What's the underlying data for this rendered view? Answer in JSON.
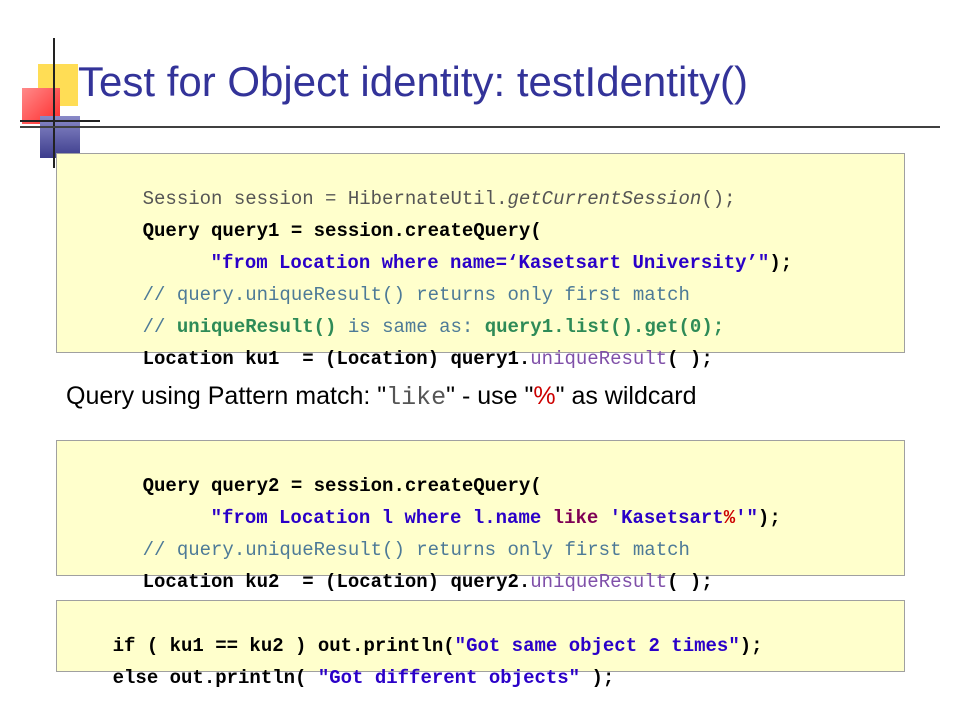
{
  "title": "Test for Object identity: testIdentity()",
  "caption": {
    "part1": "Query using Pattern match: \"",
    "like": "like",
    "part2": "\" - use \"",
    "pct": "%",
    "part3": "\" as wildcard"
  },
  "box1": {
    "l1a": "Session session = HibernateUtil.",
    "l1b": "getCurrentSession",
    "l1c": "();",
    "l2": "Query query1 = session.createQuery(",
    "l3a": "\"from Location where name=‘Kasetsart University’\"",
    "l3b": ");",
    "l4": "// query.uniqueResult() returns only first match",
    "l5a": "// ",
    "l5b": "uniqueResult()",
    "l5c": " is same as: ",
    "l5d": "query1.list().get(0);",
    "l6a": "Location ku1  = (Location) query1.",
    "l6b": "uniqueResult",
    "l6c": "( );"
  },
  "box2": {
    "l1": "Query query2 = session.createQuery(",
    "l2a": "\"from Location l where l.name ",
    "l2b": "like",
    "l2c": " 'Kasetsart",
    "l2d": "%",
    "l2e": "'\"",
    "l2f": ");",
    "l3": "// query.uniqueResult() returns only first match",
    "l4a": "Location ku2  = (Location) query2.",
    "l4b": "uniqueResult",
    "l4c": "( );"
  },
  "box3": {
    "l1a": "if ( ku1 == ku2 ) out.println(",
    "l1b": "\"Got same object 2 times\"",
    "l1c": ");",
    "l2a": "else out.println( ",
    "l2b": "\"Got different objects\"",
    "l2c": " );"
  },
  "colors": {
    "title": "#333399",
    "code_background": "#ffffcc",
    "deco_yellow": "#ffdd55",
    "deco_red": "#ff5050",
    "deco_blue": "#5555aa"
  }
}
